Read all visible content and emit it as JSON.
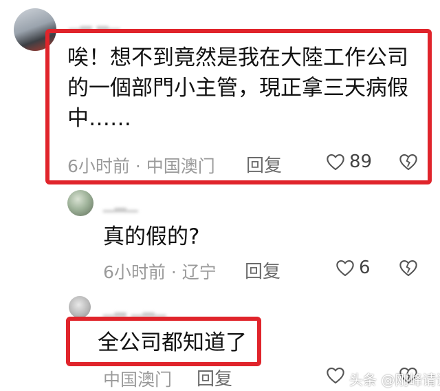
{
  "comments": [
    {
      "text": "唉！想不到竟然是我在大陸工作公司的一個部門小主管，現正拿三天病假中……",
      "time": "6小时前",
      "sep": "·",
      "location": "中国澳门",
      "reply_label": "回复",
      "likes": "89"
    },
    {
      "text": "真的假的?",
      "time": "6小时前",
      "sep": "·",
      "location": "辽宁",
      "reply_label": "回复",
      "likes": "6"
    },
    {
      "text": "全公司都知道了",
      "location": "中国澳门",
      "reply_label": "回复"
    }
  ],
  "watermark": "头条 @刚峰请说",
  "colors": {
    "highlight": "#e0242b",
    "meta": "#9a9a9a"
  },
  "icons": [
    "heart-icon",
    "dislike-icon",
    "toutiao-logo-icon"
  ]
}
